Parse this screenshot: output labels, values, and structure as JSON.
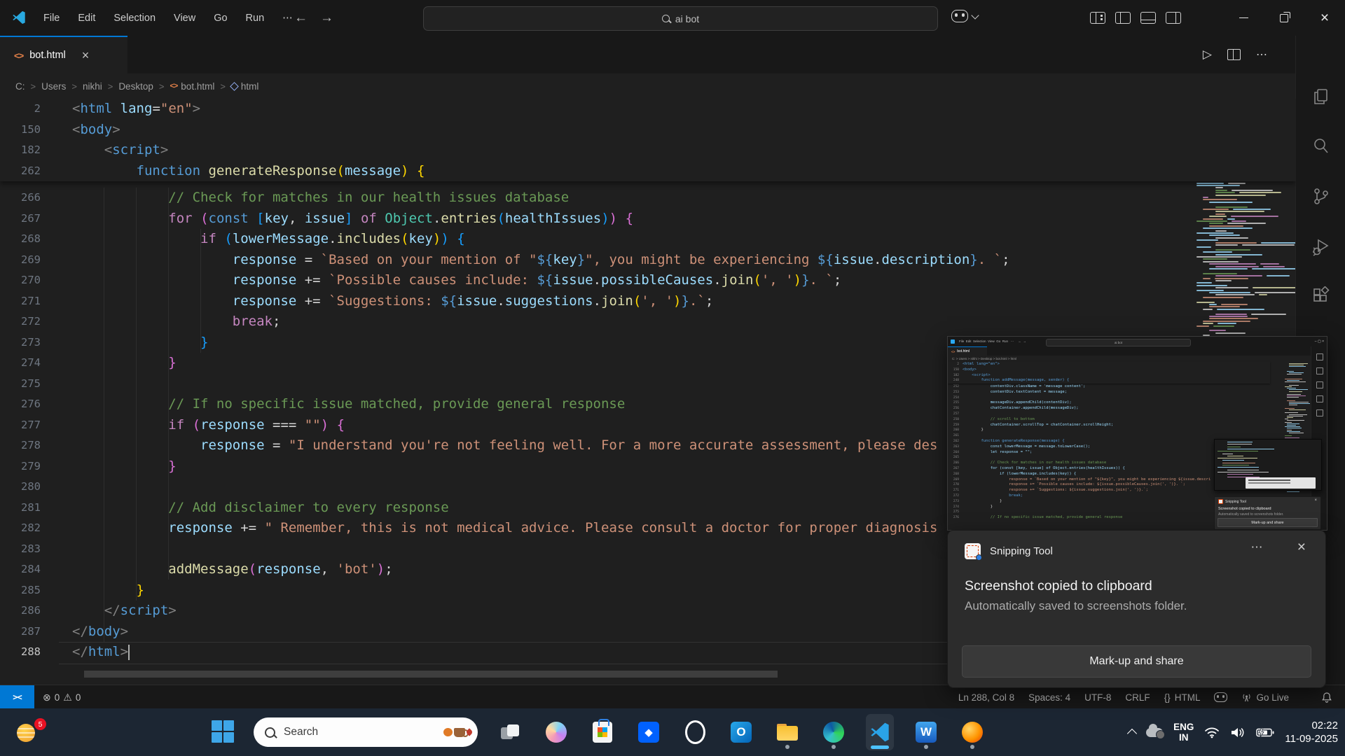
{
  "icons": {
    "error": "⊗",
    "warning": "⚠",
    "play": "▷",
    "more": "⋯",
    "close": "×",
    "back": "←",
    "forward": "→",
    "sep": ">",
    "tab_icon": "<>",
    "braces": "{}",
    "minimize": "–",
    "restore": "❐",
    "dropbox": "◆"
  },
  "titlebar": {
    "menus": [
      "File",
      "Edit",
      "Selection",
      "View",
      "Go",
      "Run"
    ],
    "search_text": "ai bot"
  },
  "tab": {
    "label": "bot.html"
  },
  "breadcrumb": [
    "C:",
    "Users",
    "nikhi",
    "Desktop",
    "bot.html",
    "html"
  ],
  "editor": {
    "sticky": [
      {
        "n": "2",
        "seg": [
          [
            "pn",
            "<"
          ],
          [
            "tg",
            "html"
          ],
          [
            "pl",
            " "
          ],
          [
            "at",
            "lang"
          ],
          [
            "pl",
            "="
          ],
          [
            "sr",
            "\"en\""
          ],
          [
            "pn",
            ">"
          ]
        ]
      },
      {
        "n": "150",
        "seg": [
          [
            "pn",
            "<"
          ],
          [
            "tg",
            "body"
          ],
          [
            "pn",
            ">"
          ]
        ]
      },
      {
        "n": "182",
        "seg": [
          [
            "pl",
            "    "
          ],
          [
            "pn",
            "<"
          ],
          [
            "tg",
            "script"
          ],
          [
            "pn",
            ">"
          ]
        ]
      },
      {
        "n": "262",
        "seg": [
          [
            "pl",
            "        "
          ],
          [
            "st",
            "function"
          ],
          [
            "pl",
            " "
          ],
          [
            "fn",
            "generateResponse"
          ],
          [
            "b1",
            "("
          ],
          [
            "vr",
            "message"
          ],
          [
            "b1",
            ")"
          ],
          [
            "pl",
            " "
          ],
          [
            "b1",
            "{"
          ]
        ]
      }
    ],
    "lines": [
      {
        "n": "266",
        "seg": [
          [
            "pl",
            "            "
          ],
          [
            "cm",
            "// Check for matches in our health issues database"
          ]
        ]
      },
      {
        "n": "267",
        "seg": [
          [
            "pl",
            "            "
          ],
          [
            "kw",
            "for"
          ],
          [
            "pl",
            " "
          ],
          [
            "b2",
            "("
          ],
          [
            "st",
            "const"
          ],
          [
            "pl",
            " "
          ],
          [
            "b3",
            "["
          ],
          [
            "vr",
            "key"
          ],
          [
            "pl",
            ", "
          ],
          [
            "vr",
            "issue"
          ],
          [
            "b3",
            "]"
          ],
          [
            "pl",
            " "
          ],
          [
            "kw",
            "of"
          ],
          [
            "pl",
            " "
          ],
          [
            "cl",
            "Object"
          ],
          [
            "pl",
            "."
          ],
          [
            "fn",
            "entries"
          ],
          [
            "b3",
            "("
          ],
          [
            "vr",
            "healthIssues"
          ],
          [
            "b3",
            ")"
          ],
          [
            "b2",
            ")"
          ],
          [
            "pl",
            " "
          ],
          [
            "b2",
            "{"
          ]
        ]
      },
      {
        "n": "268",
        "seg": [
          [
            "pl",
            "                "
          ],
          [
            "kw",
            "if"
          ],
          [
            "pl",
            " "
          ],
          [
            "b3",
            "("
          ],
          [
            "vr",
            "lowerMessage"
          ],
          [
            "pl",
            "."
          ],
          [
            "fn",
            "includes"
          ],
          [
            "b1",
            "("
          ],
          [
            "vr",
            "key"
          ],
          [
            "b1",
            ")"
          ],
          [
            "b3",
            ")"
          ],
          [
            "pl",
            " "
          ],
          [
            "b3",
            "{"
          ]
        ]
      },
      {
        "n": "269",
        "seg": [
          [
            "pl",
            "                    "
          ],
          [
            "vr",
            "response"
          ],
          [
            "pl",
            " = "
          ],
          [
            "sr",
            "`Based on your mention of \""
          ],
          [
            "tp",
            "${"
          ],
          [
            "vr",
            "key"
          ],
          [
            "tp",
            "}"
          ],
          [
            "sr",
            "\", you might be experiencing "
          ],
          [
            "tp",
            "${"
          ],
          [
            "vr",
            "issue"
          ],
          [
            "pl",
            "."
          ],
          [
            "vr",
            "description"
          ],
          [
            "tp",
            "}"
          ],
          [
            "sr",
            ". `"
          ],
          [
            "pl",
            ";"
          ]
        ]
      },
      {
        "n": "270",
        "seg": [
          [
            "pl",
            "                    "
          ],
          [
            "vr",
            "response"
          ],
          [
            "pl",
            " += "
          ],
          [
            "sr",
            "`Possible causes include: "
          ],
          [
            "tp",
            "${"
          ],
          [
            "vr",
            "issue"
          ],
          [
            "pl",
            "."
          ],
          [
            "vr",
            "possibleCauses"
          ],
          [
            "pl",
            "."
          ],
          [
            "fn",
            "join"
          ],
          [
            "b1",
            "("
          ],
          [
            "sr",
            "', '"
          ],
          [
            "b1",
            ")"
          ],
          [
            "tp",
            "}"
          ],
          [
            "sr",
            ". `"
          ],
          [
            "pl",
            ";"
          ]
        ]
      },
      {
        "n": "271",
        "seg": [
          [
            "pl",
            "                    "
          ],
          [
            "vr",
            "response"
          ],
          [
            "pl",
            " += "
          ],
          [
            "sr",
            "`Suggestions: "
          ],
          [
            "tp",
            "${"
          ],
          [
            "vr",
            "issue"
          ],
          [
            "pl",
            "."
          ],
          [
            "vr",
            "suggestions"
          ],
          [
            "pl",
            "."
          ],
          [
            "fn",
            "join"
          ],
          [
            "b1",
            "("
          ],
          [
            "sr",
            "', '"
          ],
          [
            "b1",
            ")"
          ],
          [
            "tp",
            "}"
          ],
          [
            "sr",
            ".`"
          ],
          [
            "pl",
            ";"
          ]
        ]
      },
      {
        "n": "272",
        "seg": [
          [
            "pl",
            "                    "
          ],
          [
            "kw",
            "break"
          ],
          [
            "pl",
            ";"
          ]
        ]
      },
      {
        "n": "273",
        "seg": [
          [
            "pl",
            "                "
          ],
          [
            "b3",
            "}"
          ]
        ]
      },
      {
        "n": "274",
        "seg": [
          [
            "pl",
            "            "
          ],
          [
            "b2",
            "}"
          ]
        ]
      },
      {
        "n": "275",
        "seg": []
      },
      {
        "n": "276",
        "seg": [
          [
            "pl",
            "            "
          ],
          [
            "cm",
            "// If no specific issue matched, provide general response"
          ]
        ]
      },
      {
        "n": "277",
        "seg": [
          [
            "pl",
            "            "
          ],
          [
            "kw",
            "if"
          ],
          [
            "pl",
            " "
          ],
          [
            "b2",
            "("
          ],
          [
            "vr",
            "response"
          ],
          [
            "pl",
            " === "
          ],
          [
            "sr",
            "\"\""
          ],
          [
            "b2",
            ")"
          ],
          [
            "pl",
            " "
          ],
          [
            "b2",
            "{"
          ]
        ]
      },
      {
        "n": "278",
        "seg": [
          [
            "pl",
            "                "
          ],
          [
            "vr",
            "response"
          ],
          [
            "pl",
            " = "
          ],
          [
            "sr",
            "\"I understand you're not feeling well. For a more accurate assessment, please des"
          ]
        ]
      },
      {
        "n": "279",
        "seg": [
          [
            "pl",
            "            "
          ],
          [
            "b2",
            "}"
          ]
        ]
      },
      {
        "n": "280",
        "seg": []
      },
      {
        "n": "281",
        "seg": [
          [
            "pl",
            "            "
          ],
          [
            "cm",
            "// Add disclaimer to every response"
          ]
        ]
      },
      {
        "n": "282",
        "seg": [
          [
            "pl",
            "            "
          ],
          [
            "vr",
            "response"
          ],
          [
            "pl",
            " += "
          ],
          [
            "sr",
            "\" Remember, this is not medical advice. Please consult a doctor for proper diagnosis"
          ]
        ]
      },
      {
        "n": "283",
        "seg": []
      },
      {
        "n": "284",
        "seg": [
          [
            "pl",
            "            "
          ],
          [
            "fn",
            "addMessage"
          ],
          [
            "b2",
            "("
          ],
          [
            "vr",
            "response"
          ],
          [
            "pl",
            ", "
          ],
          [
            "sr",
            "'bot'"
          ],
          [
            "b2",
            ")"
          ],
          [
            "pl",
            ";"
          ]
        ]
      },
      {
        "n": "285",
        "seg": [
          [
            "pl",
            "        "
          ],
          [
            "b1",
            "}"
          ]
        ]
      },
      {
        "n": "286",
        "seg": [
          [
            "pl",
            "    "
          ],
          [
            "pn",
            "</"
          ],
          [
            "tg",
            "script"
          ],
          [
            "pn",
            ">"
          ]
        ]
      },
      {
        "n": "287",
        "seg": [
          [
            "pn",
            "</"
          ],
          [
            "tg",
            "body"
          ],
          [
            "pn",
            ">"
          ]
        ]
      },
      {
        "n": "288",
        "seg": [
          [
            "pn",
            "</"
          ],
          [
            "tg",
            "html"
          ],
          [
            "pn",
            ">"
          ]
        ]
      }
    ],
    "active_line": "288"
  },
  "statusbar": {
    "remote_glyph": "><",
    "errors": "0",
    "warnings": "0",
    "line_col": "Ln 288, Col 8",
    "spaces": "Spaces: 4",
    "encoding": "UTF-8",
    "eol": "CRLF",
    "lang": "HTML",
    "golive": "Go Live"
  },
  "toast": {
    "app": "Snipping Tool",
    "title": "Screenshot copied to clipboard",
    "subtitle": "Automatically saved to screenshots folder.",
    "action": "Mark-up and share"
  },
  "taskbar": {
    "widgets_badge": "5",
    "search_label": "Search",
    "outlook_glyph": "O",
    "word_glyph": "W",
    "tray": {
      "lang_top": "ENG",
      "lang_bottom": "IN",
      "time": "02:22",
      "date": "11-09-2025"
    }
  },
  "mini": {
    "menus": "File  Edit  Selection  View  Go  Run   ⋯     ←  →",
    "search": "ai bot",
    "tab": "bot.html",
    "breadcrumb": "C:  >  Users  >  nikhi  >  Desktop  >  bot.html  >  html",
    "ctl": "–  ▢  ×",
    "sticky": [
      [
        "2",
        "<html lang=\"en\">",
        "k"
      ],
      [
        "150",
        "<body>",
        "k"
      ],
      [
        "182",
        "    <script>",
        "k"
      ],
      [
        "248",
        "        function addMessage(message, sender) {",
        "k"
      ]
    ],
    "lines": [
      [
        "252",
        "            contentDiv.className = 'message content';",
        "v"
      ],
      [
        "253",
        "            contentDiv.textContent = message;",
        "v"
      ],
      [
        "254",
        "",
        "p"
      ],
      [
        "255",
        "            messageDiv.appendChild(contentDiv);",
        "v"
      ],
      [
        "256",
        "            chatContainer.appendChild(messageDiv);",
        "v"
      ],
      [
        "257",
        "",
        "p"
      ],
      [
        "258",
        "            // scroll to bottom",
        "c"
      ],
      [
        "259",
        "            chatContainer.scrollTop = chatContainer.scrollHeight;",
        "v"
      ],
      [
        "260",
        "        }",
        "p"
      ],
      [
        "261",
        "",
        "p"
      ],
      [
        "262",
        "        function generateResponse(message) {",
        "k"
      ],
      [
        "263",
        "            const lowerMessage = message.toLowerCase();",
        "v"
      ],
      [
        "264",
        "            let response = \"\";",
        "v"
      ],
      [
        "265",
        "",
        "p"
      ],
      [
        "266",
        "            // Check for matches in our health issues database",
        "c"
      ],
      [
        "267",
        "            for (const [key, issue] of Object.entries(healthIssues)) {",
        "v"
      ],
      [
        "268",
        "                if (lowerMessage.includes(key)) {",
        "v"
      ],
      [
        "269",
        "                    response = `Based on your mention of \"${key}\", you might be experiencing ${issue.descri",
        "s"
      ],
      [
        "270",
        "                    response += `Possible causes include: ${issue.possibleCauses.join(', ')}. `;",
        "s"
      ],
      [
        "271",
        "                    response += `Suggestions: ${issue.suggestions.join(', ')}.`;",
        "s"
      ],
      [
        "272",
        "                    break;",
        "k"
      ],
      [
        "273",
        "                }",
        "p"
      ],
      [
        "274",
        "            }",
        "p"
      ],
      [
        "275",
        "",
        "p"
      ],
      [
        "276",
        "            // If no specific issue matched, provide general response",
        "c"
      ]
    ],
    "toast": {
      "app": "Snipping Tool",
      "line1": "Screenshot copied to clipboard",
      "line2": "Automatically saved to screenshots folder.",
      "action": "Mark-up and share"
    }
  }
}
